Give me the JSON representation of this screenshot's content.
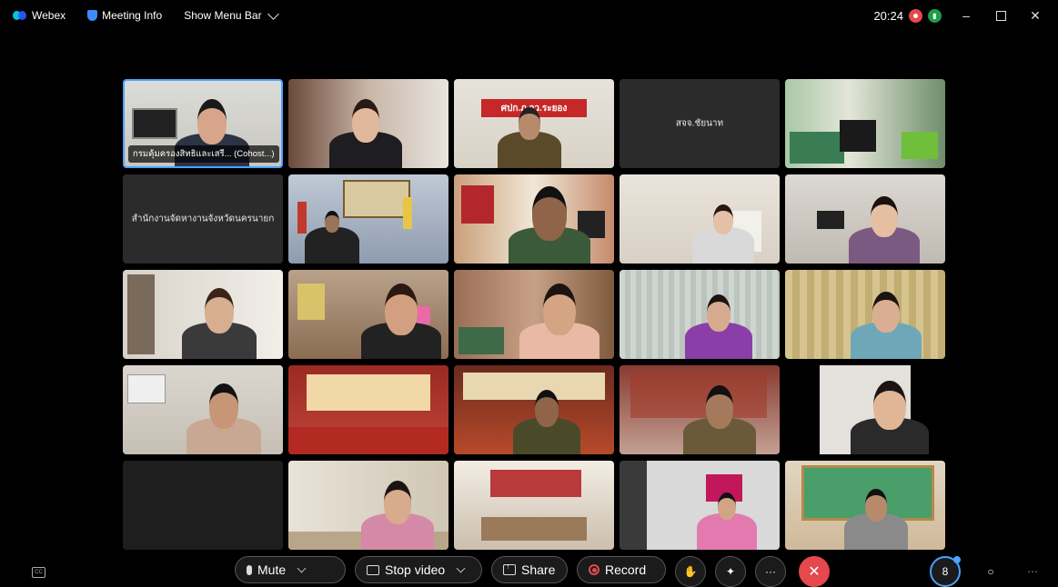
{
  "titlebar": {
    "app_name": "Webex",
    "meeting_info": "Meeting Info",
    "menu_bar": "Show Menu Bar",
    "time": "20:24",
    "minimize": "–",
    "close": "✕"
  },
  "tiles": [
    {
      "label": "กรมคุ้มครองสิทธิและเสรี... (Cohost...)",
      "scene": "office-man"
    },
    {
      "scene": "woman-office"
    },
    {
      "scene": "police-banner",
      "banner_text": "ศปก.ภ.จว.ระยอง"
    },
    {
      "name": "สจจ.ชัยนาท",
      "scene": "name-only"
    },
    {
      "scene": "office-green"
    },
    {
      "name": "สำนักงานจัดหางานจังหวัดนครนายก",
      "scene": "name-only"
    },
    {
      "scene": "blue-room"
    },
    {
      "scene": "man-red"
    },
    {
      "scene": "woman-mask"
    },
    {
      "scene": "woman-smile"
    },
    {
      "scene": "woman-young"
    },
    {
      "scene": "woman-glasses"
    },
    {
      "scene": "woman-pink"
    },
    {
      "scene": "woman-curtain"
    },
    {
      "scene": "woman-curtain2"
    },
    {
      "scene": "man-young"
    },
    {
      "scene": "red-hall"
    },
    {
      "scene": "red-banner-officer"
    },
    {
      "scene": "officer-banner"
    },
    {
      "scene": "young-man-glasses"
    },
    {
      "scene": "blank"
    },
    {
      "scene": "woman-desk"
    },
    {
      "scene": "meeting-room"
    },
    {
      "scene": "pink-room"
    },
    {
      "scene": "school-banner"
    }
  ],
  "controls": {
    "mute": "Mute",
    "stop_video": "Stop video",
    "share": "Share",
    "record": "Record",
    "more": "···",
    "leave": "✕",
    "people": "8"
  },
  "colors": {
    "accent": "#4aa3ff",
    "leave_red": "#e5484d"
  }
}
